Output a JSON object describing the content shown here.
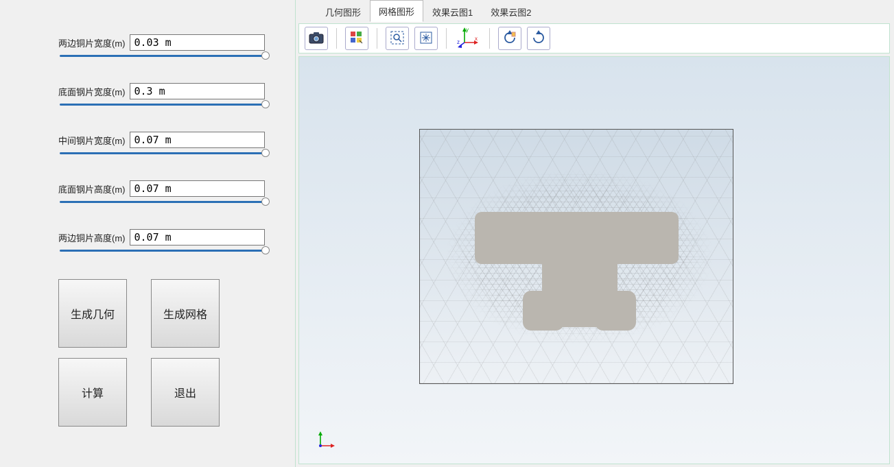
{
  "params": [
    {
      "label": "两边铜片宽度(m)",
      "value": "0.03 m"
    },
    {
      "label": "底面钢片宽度(m)",
      "value": "0.3 m"
    },
    {
      "label": "中间钢片宽度(m)",
      "value": "0.07 m"
    },
    {
      "label": "底面钢片高度(m)",
      "value": "0.07 m"
    },
    {
      "label": "两边铜片高度(m)",
      "value": "0.07 m"
    }
  ],
  "buttons": {
    "gen_geom": "生成几何",
    "gen_mesh": "生成网格",
    "compute": "计算",
    "exit": "退出"
  },
  "tabs": {
    "geom": "几何图形",
    "mesh": "网格图形",
    "cloud1": "效果云图1",
    "cloud2": "效果云图2",
    "active": "mesh"
  },
  "toolbar_icons": {
    "snapshot": "camera-icon",
    "view_grid": "view-grid-icon",
    "zoom_box": "zoom-box-icon",
    "zoom_extents": "zoom-extents-icon",
    "axis": "axis-xyz-icon",
    "rotate_ccw": "rotate-ccw-icon",
    "rotate_cw": "rotate-cw-icon"
  }
}
